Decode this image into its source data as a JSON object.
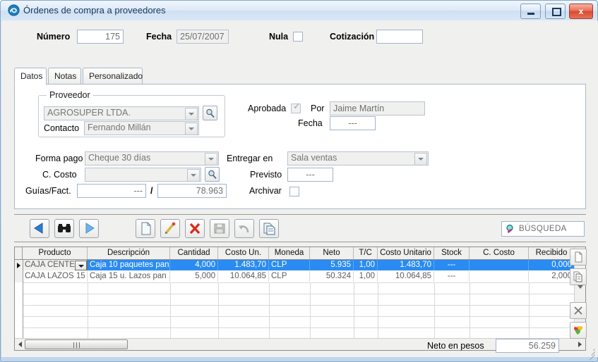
{
  "window": {
    "title": "Órdenes de compra a proveedores",
    "icon": "app-swirl-icon",
    "minimize_label": "–",
    "maximize_label": "□",
    "close_label": "x"
  },
  "header": {
    "numero_label": "Número",
    "numero_value": "175",
    "fecha_label": "Fecha",
    "fecha_value": "25/07/2007",
    "nula_label": "Nula",
    "cotizacion_label": "Cotización",
    "cotizacion_value": ""
  },
  "tabs": [
    {
      "label": "Datos",
      "active": true
    },
    {
      "label": "Notas",
      "active": false
    },
    {
      "label": "Personalizado",
      "active": false
    }
  ],
  "proveedor_group": {
    "title": "Proveedor",
    "proveedor_value": "AGROSUPER LTDA.",
    "contacto_label": "Contacto",
    "contacto_value": "Fernando Millán",
    "lens_icon": "magnifier-icon"
  },
  "aprobacion": {
    "aprobada_label": "Aprobada",
    "aprobada_checked": true,
    "por_label": "Por",
    "por_value": "Jaime Martín",
    "fecha_label": "Fecha",
    "fecha_value": "---"
  },
  "pago": {
    "forma_pago_label": "Forma pago",
    "forma_pago_value": "Cheque 30 días",
    "c_costo_label": "C. Costo",
    "c_costo_value": "",
    "guias_label": "Guías/Fact.",
    "guias_value": "---",
    "guias_separator": "/",
    "factura_value": "78.963"
  },
  "entrega": {
    "entregar_label": "Entregar en",
    "entregar_value": "Sala ventas",
    "previsto_label": "Previsto",
    "previsto_value": "---",
    "archivar_label": "Archivar",
    "archivar_checked": false
  },
  "toolbar": {
    "prev_icon": "triangle-left-icon",
    "find_icon": "binoculars-icon",
    "next_icon": "triangle-right-icon",
    "new_icon": "new-document-icon",
    "edit_icon": "pencil-icon",
    "delete_icon": "red-x-icon",
    "save_icon": "floppy-disk-icon",
    "undo_icon": "undo-arrow-icon",
    "copy_icon": "copy-documents-icon",
    "search_label": "BÚSQUEDA",
    "search_icon": "magnifier-icon"
  },
  "grid": {
    "columns": [
      "Producto",
      "Descripción",
      "Cantidad",
      "Costo Un.",
      "Moneda",
      "Neto",
      "T/C",
      "Costo Unitario",
      "Stock",
      "C. Costo",
      "Recibido"
    ],
    "rows": [
      {
        "selected": true,
        "has_dropdown": true,
        "cells": [
          "CAJA CENTE",
          "Caja 10 paquetes pan",
          "4,000",
          "1.483,70",
          "CLP",
          "5.935",
          "1,00",
          "1.483,70",
          "---",
          "",
          "0,000"
        ]
      },
      {
        "selected": false,
        "has_dropdown": false,
        "cells": [
          "CAJA LAZOS 15",
          "Caja 15 u. Lazos pan 1",
          "5,000",
          "10.064,85",
          "CLP",
          "50.324",
          "1,00",
          "10.064,85",
          "---",
          "",
          "2,000"
        ]
      }
    ]
  },
  "side_buttons": {
    "new_line_icon": "new-document-icon",
    "copy_line_icon": "copy-documents-icon",
    "delete_line_icon": "x-icon",
    "colors_icon": "colored-hearts-icon"
  },
  "footer": {
    "neto_label": "Neto en pesos",
    "neto_value": "56.259"
  }
}
